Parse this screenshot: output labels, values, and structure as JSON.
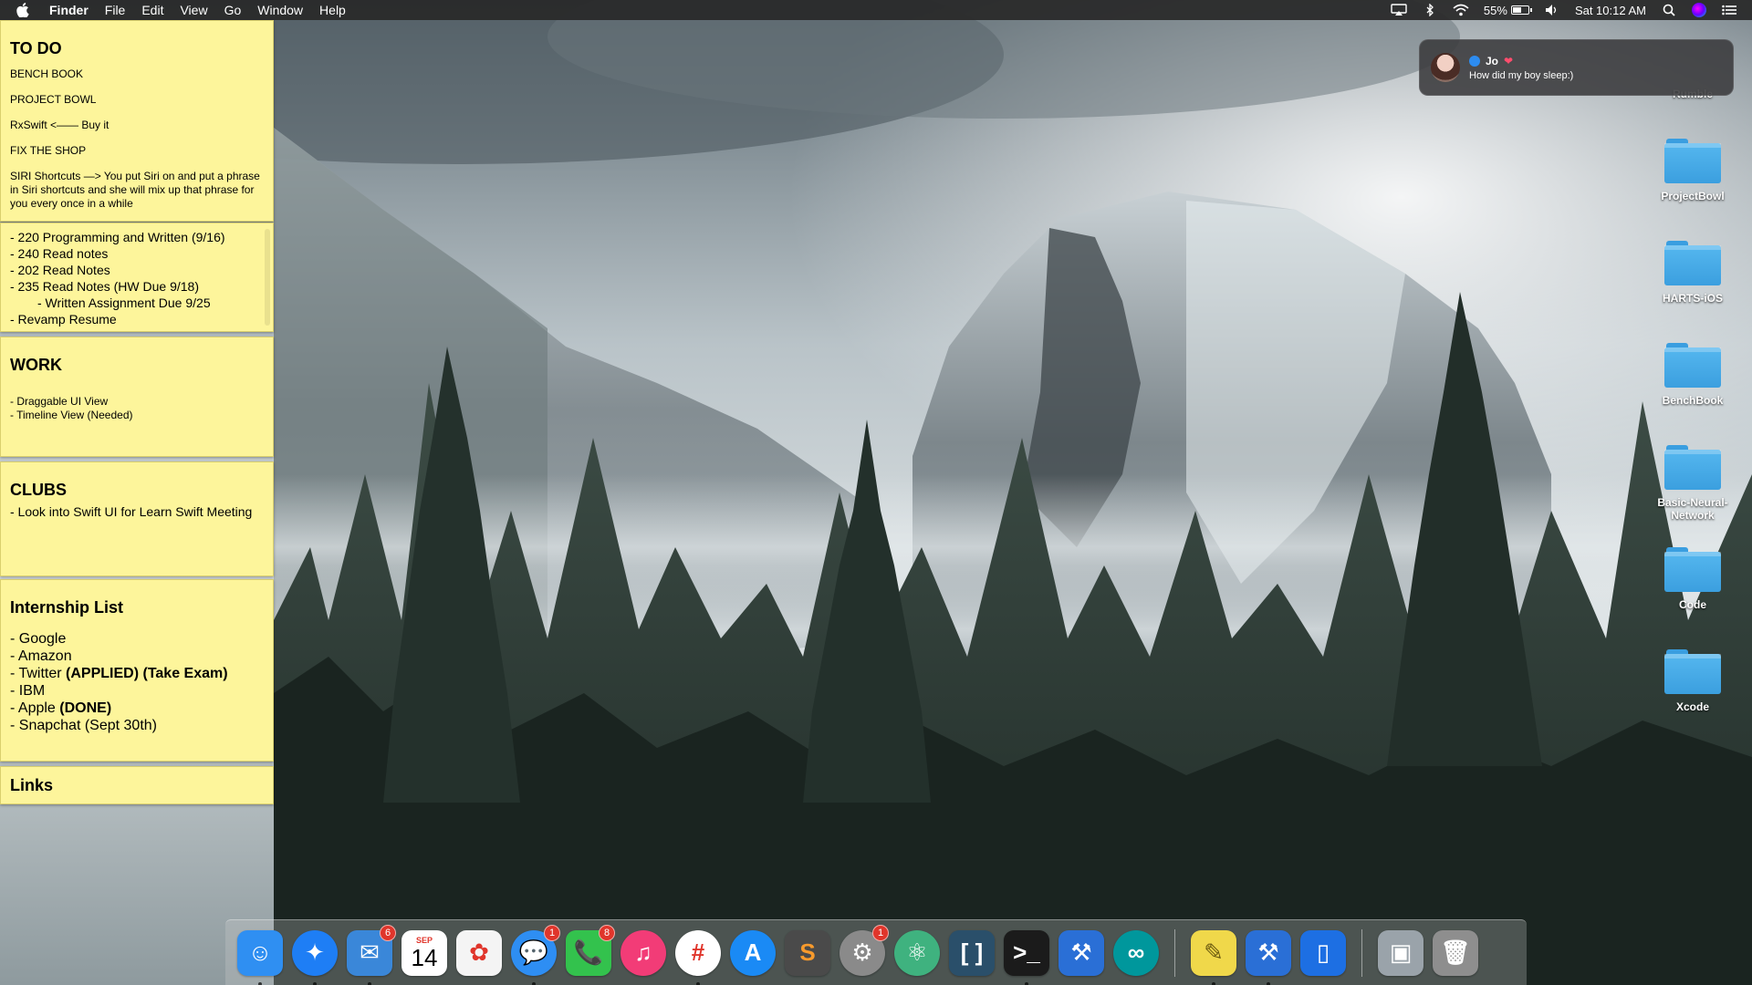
{
  "menubar": {
    "app_name": "Finder",
    "menus": [
      "File",
      "Edit",
      "View",
      "Go",
      "Window",
      "Help"
    ],
    "battery_percent": "55%",
    "battery_level": 0.55,
    "clock": "Sat 10:12 AM"
  },
  "stickies": {
    "todo": {
      "title": "TO DO",
      "items": [
        "BENCH BOOK",
        "PROJECT BOWL",
        "RxSwift <—— Buy it",
        "FIX THE SHOP",
        "SIRI Shortcuts —> You put Siri on and put a phrase in Siri shortcuts and she will mix up that phrase for you every once in a while"
      ]
    },
    "classes": {
      "lines": [
        "- 220 Programming and Written (9/16)",
        "- 240 Read notes",
        "- 202 Read Notes",
        "- 235 Read Notes (HW Due 9/18)",
        "- Written Assignment Due 9/25",
        "- Revamp Resume"
      ]
    },
    "work": {
      "title": "WORK",
      "lines": [
        "- Draggable UI View",
        "- Timeline View (Needed)"
      ]
    },
    "clubs": {
      "title": "CLUBS",
      "lines": [
        "- Look into Swift UI for Learn Swift Meeting"
      ]
    },
    "internships": {
      "title": "Internship List",
      "items": [
        {
          "text": "- Google",
          "strong": ""
        },
        {
          "text": "- Amazon",
          "strong": ""
        },
        {
          "text": "- Twitter ",
          "strong": "(APPLIED) (Take Exam)"
        },
        {
          "text": "- IBM",
          "strong": ""
        },
        {
          "text": "- Apple ",
          "strong": "(DONE)"
        },
        {
          "text": "- Snapchat (Sept 30th)",
          "strong": ""
        }
      ]
    },
    "links": {
      "title": "Links"
    }
  },
  "notification": {
    "sender": "Jo",
    "message": "How did my boy sleep:)",
    "heart": "❤"
  },
  "desktop_icons": [
    {
      "name": "Rumble",
      "icon": "folder-icon"
    },
    {
      "name": "ProjectBowl",
      "icon": "folder-icon"
    },
    {
      "name": "HARTS-iOS",
      "icon": "folder-icon"
    },
    {
      "name": "BenchBook",
      "icon": "folder-icon"
    },
    {
      "name": "Basic-Neural-Network",
      "icon": "folder-icon"
    },
    {
      "name": "Code",
      "icon": "folder-icon"
    },
    {
      "name": "Xcode",
      "icon": "folder-icon"
    }
  ],
  "dock": {
    "apps": [
      {
        "id": "finder",
        "icon": "finder-icon",
        "glyph": "☺",
        "color": "#2f8ff2",
        "running": true,
        "badge": ""
      },
      {
        "id": "safari",
        "icon": "safari-icon",
        "glyph": "✦",
        "color": "#1e7ef5",
        "running": true,
        "badge": "",
        "round": true
      },
      {
        "id": "mail",
        "icon": "mail-icon",
        "glyph": "✉",
        "color": "#3a87d9",
        "running": true,
        "badge": "6"
      },
      {
        "id": "calendar",
        "icon": "calendar-icon",
        "glyph": "",
        "color": "#ffffff",
        "running": false,
        "badge": "",
        "month": "SEP",
        "day": "14"
      },
      {
        "id": "photos",
        "icon": "photos-icon",
        "glyph": "✿",
        "color": "#f4f4f4",
        "running": false,
        "badge": ""
      },
      {
        "id": "messages",
        "icon": "messages-icon",
        "glyph": "💬",
        "color": "#2e8ef3",
        "running": true,
        "badge": "1",
        "round": true
      },
      {
        "id": "facetime",
        "icon": "facetime-icon",
        "glyph": "📞",
        "color": "#33c24d",
        "running": false,
        "badge": "8"
      },
      {
        "id": "itunes",
        "icon": "music-icon",
        "glyph": "♫",
        "color": "#f23c77",
        "running": false,
        "badge": "",
        "round": true
      },
      {
        "id": "slack",
        "icon": "slack-icon",
        "glyph": "#",
        "color": "#ffffff",
        "running": true,
        "badge": "",
        "round": true
      },
      {
        "id": "appstore",
        "icon": "app-store-icon",
        "glyph": "A",
        "color": "#1a8af5",
        "running": false,
        "badge": "",
        "round": true
      },
      {
        "id": "sublime",
        "icon": "sublime-text-icon",
        "glyph": "S",
        "color": "#4a4a4a",
        "running": false,
        "badge": ""
      },
      {
        "id": "preferences",
        "icon": "system-preferences-icon",
        "glyph": "⚙",
        "color": "#8a8a8a",
        "running": false,
        "badge": "1",
        "round": true
      },
      {
        "id": "atom",
        "icon": "atom-icon",
        "glyph": "⚛",
        "color": "#3fb27f",
        "running": false,
        "badge": "",
        "round": true
      },
      {
        "id": "brackets",
        "icon": "brackets-icon",
        "glyph": "[ ]",
        "color": "#2a4f6a",
        "running": false,
        "badge": ""
      },
      {
        "id": "terminal",
        "icon": "terminal-icon",
        "glyph": ">_",
        "color": "#1b1b1b",
        "running": true,
        "badge": ""
      },
      {
        "id": "xcode",
        "icon": "xcode-icon",
        "glyph": "⚒",
        "color": "#2a6fd6",
        "running": false,
        "badge": ""
      },
      {
        "id": "arduino",
        "icon": "arduino-icon",
        "glyph": "∞",
        "color": "#00979c",
        "running": false,
        "badge": "",
        "round": true
      },
      {
        "id": "stickies",
        "icon": "stickies-icon",
        "glyph": "✎",
        "color": "#f0d84a",
        "running": true,
        "badge": "",
        "sep_before": true
      },
      {
        "id": "xcode-beta",
        "icon": "xcode-beta-icon",
        "glyph": "⚒",
        "color": "#2a6fd6",
        "running": true,
        "badge": ""
      },
      {
        "id": "simulator",
        "icon": "simulator-icon",
        "glyph": "▯",
        "color": "#1d6fe3",
        "running": false,
        "badge": ""
      },
      {
        "id": "preview",
        "icon": "preview-icon",
        "glyph": "▣",
        "color": "#9aa3aa",
        "running": false,
        "badge": "",
        "sep_before": true
      },
      {
        "id": "trash",
        "icon": "trash-icon",
        "glyph": "🗑",
        "color": "#8e8e8e",
        "running": false,
        "badge": ""
      }
    ]
  }
}
